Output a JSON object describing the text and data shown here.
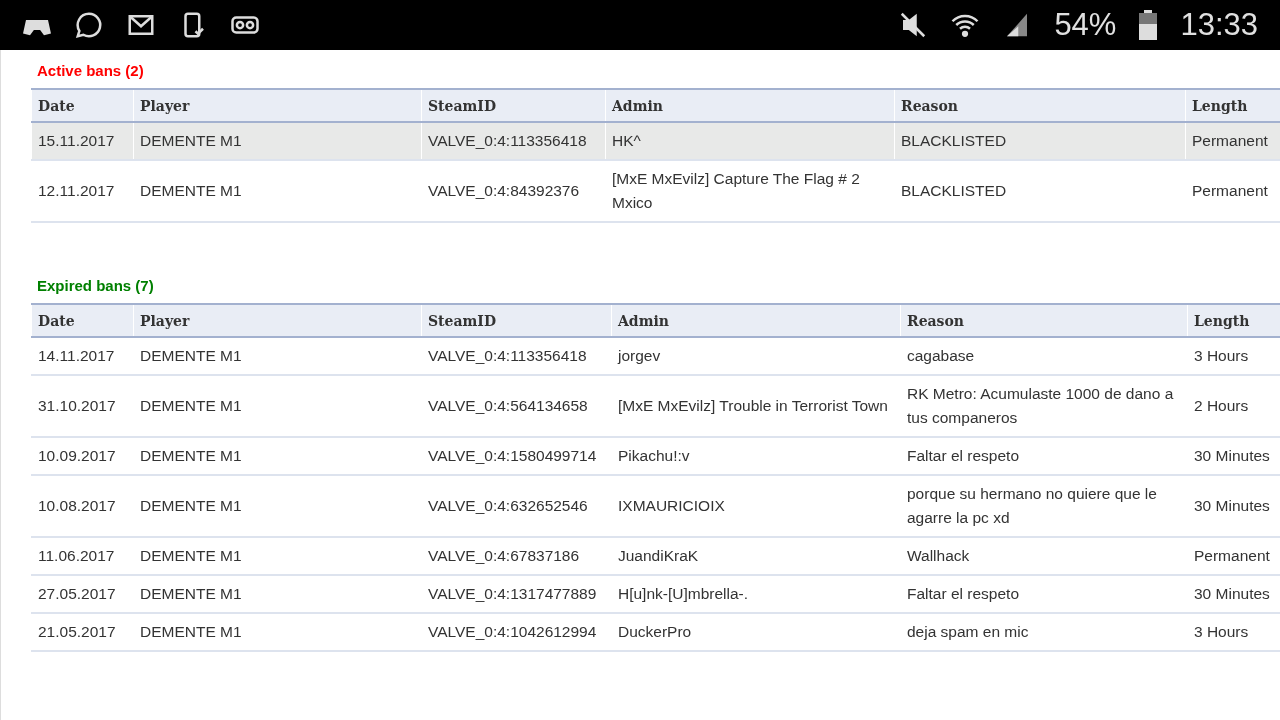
{
  "status_bar": {
    "battery": "54%",
    "time": "13:33"
  },
  "sections": [
    {
      "title": "Active bans (2)",
      "kind": "active",
      "columns": [
        "Date",
        "Player",
        "SteamID",
        "Admin",
        "Reason",
        "Length"
      ],
      "rows": [
        {
          "highlighted": true,
          "cells": [
            "15.11.2017",
            "DEMENTE M1",
            "VALVE_0:4:113356418",
            "HK^",
            "BLACKLISTED",
            "Permanent"
          ]
        },
        {
          "highlighted": false,
          "cells": [
            "12.11.2017",
            "DEMENTE M1",
            "VALVE_0:4:84392376",
            "[MxE MxEvilz] Capture The Flag # 2 Mxico",
            "BLACKLISTED",
            "Permanent"
          ]
        }
      ]
    },
    {
      "title": "Expired bans (7)",
      "kind": "expired",
      "columns": [
        "Date",
        "Player",
        "SteamID",
        "Admin",
        "Reason",
        "Length"
      ],
      "rows": [
        {
          "highlighted": false,
          "cells": [
            "14.11.2017",
            "DEMENTE M1",
            "VALVE_0:4:113356418",
            "jorgev",
            "cagabase",
            "3 Hours"
          ]
        },
        {
          "highlighted": false,
          "cells": [
            "31.10.2017",
            "DEMENTE M1",
            "VALVE_0:4:564134658",
            "[MxE MxEvilz] Trouble in Terrorist Town",
            "RK Metro: Acumulaste 1000 de dano a tus companeros",
            "2 Hours"
          ]
        },
        {
          "highlighted": false,
          "cells": [
            "10.09.2017",
            "DEMENTE M1",
            "VALVE_0:4:1580499714",
            "Pikachu!:v",
            "Faltar el respeto",
            "30 Minutes"
          ]
        },
        {
          "highlighted": false,
          "cells": [
            "10.08.2017",
            "DEMENTE M1",
            "VALVE_0:4:632652546",
            "IXMAURICIOIX",
            "porque su hermano no quiere que le agarre la pc xd",
            "30 Minutes"
          ]
        },
        {
          "highlighted": false,
          "cells": [
            "11.06.2017",
            "DEMENTE M1",
            "VALVE_0:4:67837186",
            "JuandiKraK",
            "Wallhack",
            "Permanent"
          ]
        },
        {
          "highlighted": false,
          "cells": [
            "27.05.2017",
            "DEMENTE M1",
            "VALVE_0:4:1317477889",
            "H[u]nk-[U]mbrella-.",
            "Faltar el respeto",
            "30 Minutes"
          ]
        },
        {
          "highlighted": false,
          "cells": [
            "21.05.2017",
            "DEMENTE M1",
            "VALVE_0:4:1042612994",
            "DuckerPro",
            "deja spam en mic",
            "3 Hours"
          ]
        }
      ]
    }
  ]
}
